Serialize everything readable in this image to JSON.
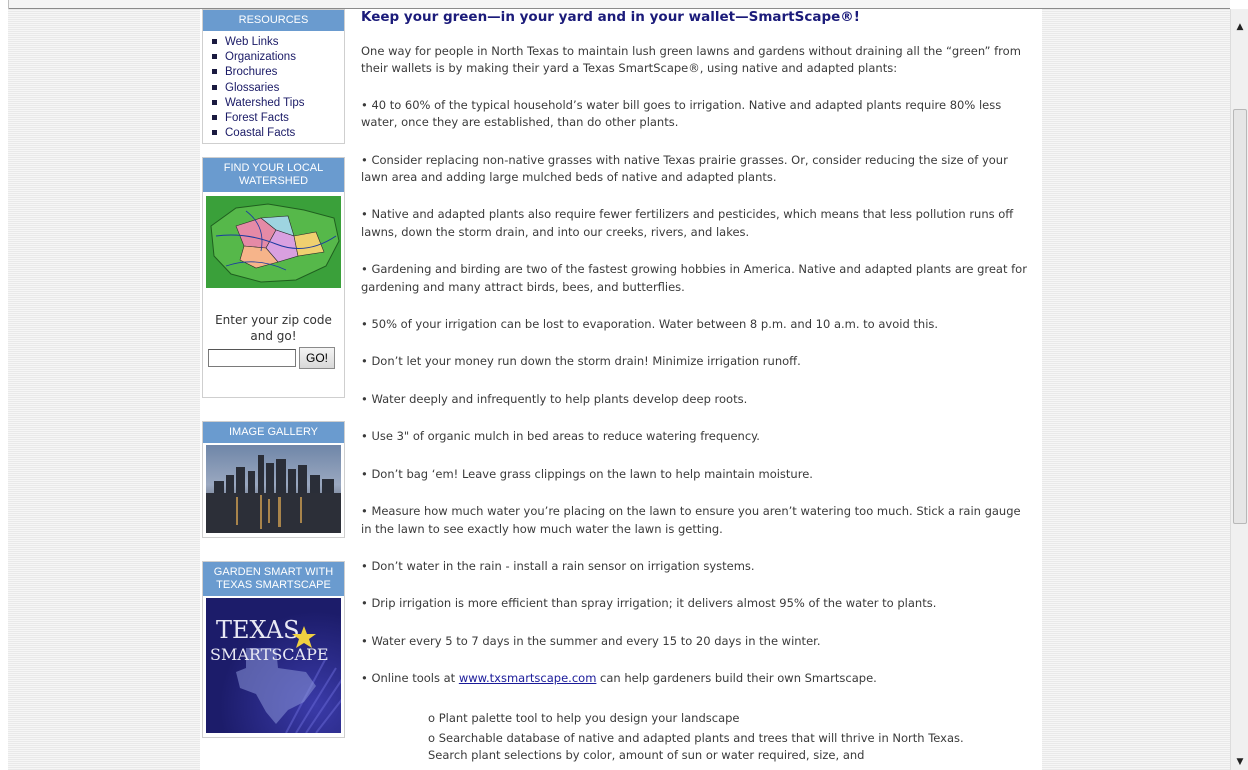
{
  "sidebar": {
    "resources": {
      "title": "RESOURCES",
      "items": [
        "Web Links",
        "Organizations",
        "Brochures",
        "Glossaries",
        "Watershed Tips",
        "Forest Facts",
        "Coastal Facts"
      ]
    },
    "watershed": {
      "title": "FIND YOUR LOCAL WATERSHED",
      "zip_prompt": "Enter your zip code and go!",
      "zip_value": "",
      "go_label": "GO!"
    },
    "gallery": {
      "title": "IMAGE GALLERY"
    },
    "garden": {
      "title": "GARDEN SMART WITH TEXAS SMARTSCAPE",
      "logo_text": "TEXAS SMARTSCAPE"
    }
  },
  "main": {
    "title": "Keep your green—in your yard and in your wallet—SmartScape®!",
    "intro": "One way for people in North Texas to maintain lush green lawns and gardens without draining all the “green” from their wallets is by making their yard a Texas SmartScape®, using native and adapted plants:",
    "bullets": [
      "• 40 to 60% of the typical household’s water bill goes to irrigation. Native and adapted plants require 80% less water, once they are established, than do other plants.",
      "• Consider replacing non-native grasses with native Texas prairie grasses. Or, consider reducing the size of your lawn area and adding large mulched beds of native and adapted plants.",
      "• Native and adapted plants also require fewer fertilizers and pesticides, which means that less pollution runs off lawns, down the storm drain, and into our creeks, rivers, and lakes.",
      "• Gardening and birding are two of the fastest growing hobbies in America. Native and adapted plants are great for gardening and many attract birds, bees, and butterflies.",
      "• 50% of your irrigation can be lost to evaporation. Water between 8 p.m. and 10 a.m. to avoid this.",
      "• Don’t let your money run down the storm drain! Minimize irrigation runoff.",
      "• Water deeply and infrequently to help plants develop deep roots.",
      "• Use 3\" of organic mulch in bed areas to reduce watering frequency.",
      "• Don’t bag ‘em! Leave grass clippings on the lawn to help maintain moisture.",
      "• Measure how much water you’re placing on the lawn to ensure you aren’t watering too much. Stick a rain gauge in the lawn to see exactly how much water the lawn is getting.",
      "• Don’t water in the rain - install a rain sensor on irrigation systems.",
      "• Drip irrigation is more efficient than spray irrigation; it delivers almost 95% of the water to plants.",
      "• Water every 5 to 7 days in the summer and every 15 to 20 days in the winter."
    ],
    "online": {
      "prefix": "• Online tools at ",
      "link": "www.txsmartscape.com",
      "suffix": " can help gardeners build their own Smartscape."
    },
    "subitems": [
      "o Plant palette tool to help you design your landscape",
      "o Searchable database of native and adapted plants and trees that will thrive in North Texas. Search plant selections by color, amount of sun or water required, size, and"
    ]
  },
  "colors": {
    "header_blue": "#6a9bcf",
    "title_navy": "#1b1b7a"
  }
}
